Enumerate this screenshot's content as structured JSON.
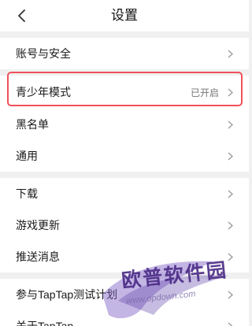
{
  "header": {
    "title": "设置",
    "back_icon": "chevron-left-icon"
  },
  "groups": [
    {
      "items": [
        {
          "label": "账号与安全"
        }
      ]
    },
    {
      "items": [
        {
          "label": "青少年模式",
          "value": "已开启",
          "highlighted": true
        },
        {
          "label": "黑名单"
        },
        {
          "label": "通用"
        }
      ]
    },
    {
      "items": [
        {
          "label": "下载"
        },
        {
          "label": "游戏更新"
        },
        {
          "label": "推送消息"
        }
      ]
    },
    {
      "items": [
        {
          "label": "参与TapTap测试计划"
        },
        {
          "label": "关于TapTap"
        }
      ]
    }
  ],
  "watermark": {
    "text": "欧普软件园",
    "url": "www.opdown.com"
  },
  "colors": {
    "highlight_border": "#f0515a",
    "background": "#f0f0f0",
    "watermark": "#4a2a86"
  }
}
